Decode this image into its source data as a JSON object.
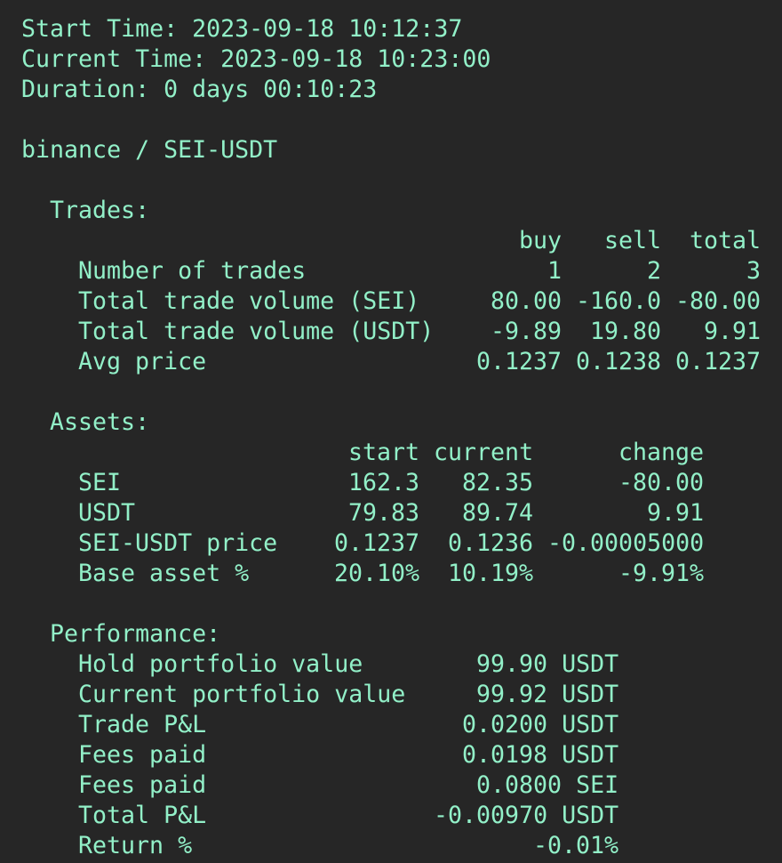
{
  "colors": {
    "background": "#262626",
    "text": "#92f0c8"
  },
  "header": {
    "start_time": "Start Time: 2023-09-18 10:12:37",
    "current_time": "Current Time: 2023-09-18 10:23:00",
    "duration": "Duration: 0 days 00:10:23",
    "market": "binance / SEI-USDT"
  },
  "trades": {
    "heading": "Trades:",
    "columns": {
      "buy": "buy",
      "sell": "sell",
      "total": "total"
    },
    "rows": [
      {
        "label": "Number of trades",
        "buy": "1",
        "sell": "2",
        "total": "3"
      },
      {
        "label": "Total trade volume (SEI)",
        "buy": "80.00",
        "sell": "-160.0",
        "total": "-80.00"
      },
      {
        "label": "Total trade volume (USDT)",
        "buy": "-9.89",
        "sell": "19.80",
        "total": "9.91"
      },
      {
        "label": "Avg price",
        "buy": "0.1237",
        "sell": "0.1238",
        "total": "0.1237"
      }
    ]
  },
  "assets": {
    "heading": "Assets:",
    "columns": {
      "start": "start",
      "current": "current",
      "change": "change"
    },
    "rows": [
      {
        "label": "SEI",
        "start": "162.3",
        "current": "82.35",
        "change": "-80.00"
      },
      {
        "label": "USDT",
        "start": "79.83",
        "current": "89.74",
        "change": "9.91"
      },
      {
        "label": "SEI-USDT price",
        "start": "0.1237",
        "current": "0.1236",
        "change": "-0.00005000"
      },
      {
        "label": "Base asset %",
        "start": "20.10%",
        "current": "10.19%",
        "change": "-9.91%"
      }
    ]
  },
  "performance": {
    "heading": "Performance:",
    "rows": [
      {
        "label": "Hold portfolio value",
        "value": "99.90 USDT"
      },
      {
        "label": "Current portfolio value",
        "value": "99.92 USDT"
      },
      {
        "label": "Trade P&L",
        "value": "0.0200 USDT"
      },
      {
        "label": "Fees paid",
        "value": "0.0198 USDT"
      },
      {
        "label": "Fees paid",
        "value": "0.0800 SEI"
      },
      {
        "label": "Total P&L",
        "value": "-0.00970 USDT"
      },
      {
        "label": "Return %",
        "value": "-0.01%"
      }
    ]
  }
}
